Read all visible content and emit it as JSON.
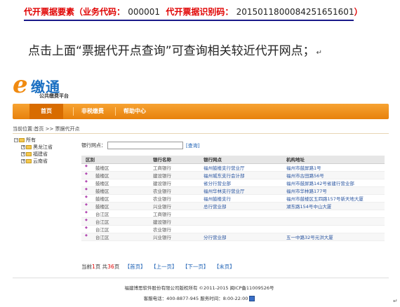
{
  "doc": {
    "label1": "代开票据要素",
    "paren_open": "（",
    "label2": "业务代码：",
    "value2": "000001",
    "label3": "代开票据识别码：",
    "value3": "2015011800084251651601",
    "paren_close": "）",
    "instruction": "点击上面“票据代开点查询”可查询相关较近代开网点；",
    "mark": "↵"
  },
  "app": {
    "logo_e": "e",
    "logo_brand": "缴通",
    "logo_sub": "公共缴费平台",
    "nav": [
      "首页",
      "非税缴费",
      "帮助中心"
    ],
    "breadcrumb": "当前位置:首页 >> 票据代开点",
    "tree": {
      "root": "所有",
      "children": [
        "黑龙江省",
        "福建省",
        "云南省"
      ]
    },
    "search": {
      "label": "银行网点：",
      "value": "",
      "button": "[查询]"
    },
    "table": {
      "headers": [
        "区别",
        "银行名称",
        "银行网点",
        "机构地址"
      ],
      "rows": [
        [
          "鼓楼区",
          "工商银行",
          "福州鼓楼支行营业厅",
          "福州市鼓屏路1号"
        ],
        [
          "鼓楼区",
          "建设银行",
          "福州城东支行会计部",
          "福州市古田路56号"
        ],
        [
          "鼓楼区",
          "建设银行",
          "省分行营业部",
          "福州市鼓屏路142号省建行营业部"
        ],
        [
          "鼓楼区",
          "农业银行",
          "福州华林支行营业厅",
          "福州市华林路177号"
        ],
        [
          "鼓楼区",
          "农业银行",
          "福州鼓楼支行",
          "福州市鼓楼区五四路157号新天地大厦"
        ],
        [
          "鼓楼区",
          "兴业银行",
          "总行营业部",
          "湖东路154号中山大厦"
        ],
        [
          "台江区",
          "工商银行",
          "",
          ""
        ],
        [
          "台江区",
          "建设银行",
          "",
          ""
        ],
        [
          "台江区",
          "农业银行",
          "",
          ""
        ],
        [
          "台江区",
          "兴业银行",
          "分行营业部",
          "五一中路32号元洪大厦"
        ]
      ]
    },
    "pager": {
      "prefix": "当前",
      "current": "1",
      "middle": "页 共",
      "total": "36",
      "suffix": "页",
      "first": "【首页】",
      "prev": "【上一页】",
      "next": "【下一页】",
      "last": "【末页】"
    },
    "copyright": "福建博思软件股份有限公司版权所有   ©2011-2015 闽ICP备11009526号",
    "service": "客服电话：400-8877-945  服务时间：8:00-22:00"
  }
}
